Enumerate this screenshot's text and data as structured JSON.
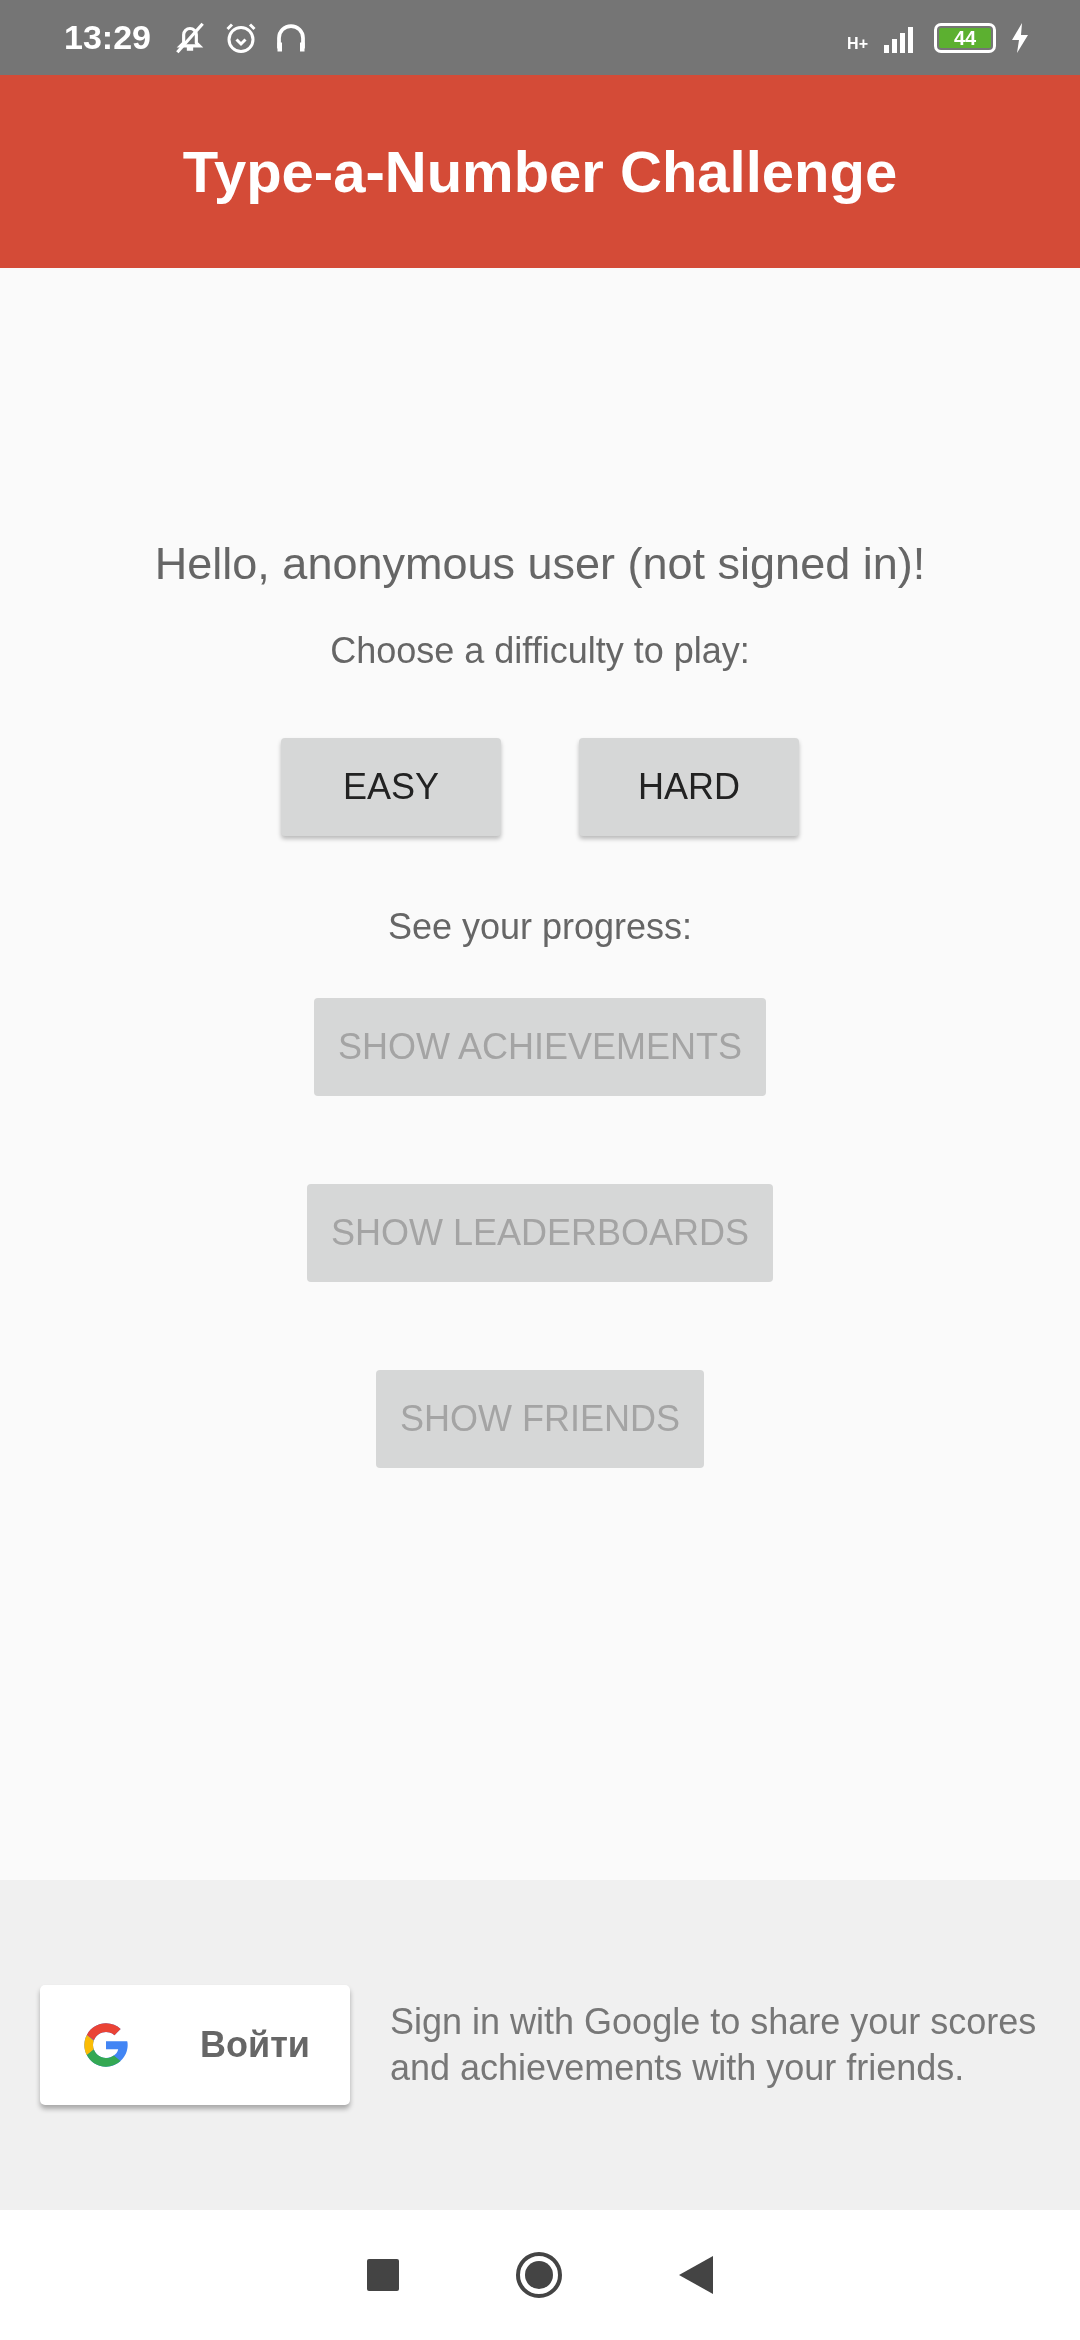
{
  "status_bar": {
    "time": "13:29",
    "network": "H+",
    "battery": "44"
  },
  "app_bar": {
    "title": "Type-a-Number Challenge"
  },
  "greeting": "Hello, anonymous user (not signed in)!",
  "difficulty_prompt": "Choose a difficulty to play:",
  "difficulty_buttons": [
    {
      "label": "EASY",
      "disabled": false
    },
    {
      "label": "HARD",
      "disabled": false
    }
  ],
  "progress_prompt": "See your progress:",
  "progress_buttons": [
    {
      "label": "SHOW ACHIEVEMENTS",
      "disabled": true
    },
    {
      "label": "SHOW LEADERBOARDS",
      "disabled": true
    },
    {
      "label": "SHOW FRIENDS",
      "disabled": true
    }
  ],
  "sign_in": {
    "button_label": "Войти",
    "text": "Sign in with Google to share your scores and achievements with your friends."
  }
}
